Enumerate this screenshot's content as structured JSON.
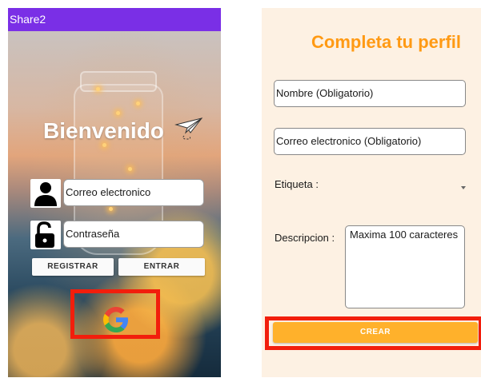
{
  "left_screen": {
    "app_title": "Share2",
    "welcome": "Bienvenido",
    "email_placeholder": "Correo electronico",
    "password_placeholder": "Contraseña",
    "register_label": "REGISTRAR",
    "enter_label": "ENTRAR",
    "google_icon": "google-g-icon",
    "user_icon": "person-icon",
    "lock_icon": "unlocked-padlock-icon",
    "plane_icon": "paper-plane-icon"
  },
  "right_screen": {
    "title": "Completa tu perfil",
    "name_placeholder": "Nombre (Obligatorio)",
    "email_placeholder": "Correo electronico (Obligatorio)",
    "tag_label": "Etiqueta :",
    "description_label": "Descripcion :",
    "description_placeholder": "Maxima 100 caracteres",
    "create_label": "CREAR"
  },
  "colors": {
    "appbar": "#7a2fe6",
    "accent_orange": "#ff9a14",
    "button_orange": "#ffb12b",
    "highlight_red": "#f21e0c",
    "right_bg": "#fdf1e3"
  }
}
